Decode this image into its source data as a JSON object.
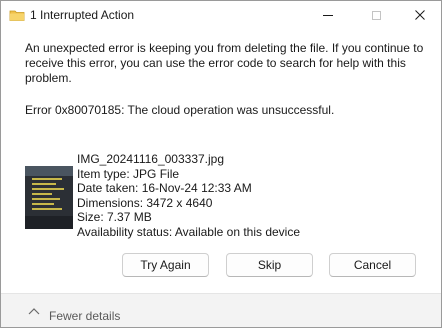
{
  "window": {
    "title": "1 Interrupted Action"
  },
  "dialog": {
    "message": "An unexpected error is keeping you from deleting the file. If you continue to receive this error, you can use the error code to search for help with this problem.",
    "error": "Error 0x80070185: The cloud operation was unsuccessful."
  },
  "file": {
    "name": "IMG_20241116_003337.jpg",
    "item_type": "Item type: JPG File",
    "date_taken": "Date taken: 16-Nov-24 12:33 AM",
    "dimensions": "Dimensions: 3472 x 4640",
    "size": "Size: 7.37 MB",
    "availability": "Availability status: Available on this device"
  },
  "buttons": {
    "try_again": "Try Again",
    "skip": "Skip",
    "cancel": "Cancel"
  },
  "footer": {
    "fewer_details": "Fewer details"
  },
  "icons": {
    "app": "file-explorer-icon",
    "minimize": "minimize-icon",
    "maximize": "maximize-icon",
    "close": "close-icon",
    "chevron": "chevron-up-icon"
  },
  "colors": {
    "app_icon": "#f0c14b",
    "footer_bg": "#f3f3f3"
  }
}
